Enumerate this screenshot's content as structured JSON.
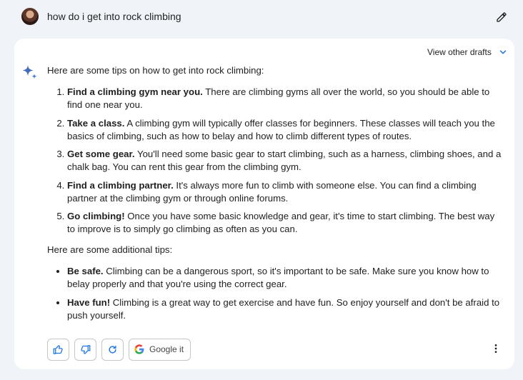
{
  "prompt": {
    "text": "how do i get into rock climbing"
  },
  "response": {
    "drafts_label": "View other drafts",
    "intro": "Here are some tips on how to get into rock climbing:",
    "steps": [
      {
        "title": "Find a climbing gym near you.",
        "body": " There are climbing gyms all over the world, so you should be able to find one near you."
      },
      {
        "title": "Take a class.",
        "body": " A climbing gym will typically offer classes for beginners. These classes will teach you the basics of climbing, such as how to belay and how to climb different types of routes."
      },
      {
        "title": "Get some gear.",
        "body": " You'll need some basic gear to start climbing, such as a harness, climbing shoes, and a chalk bag. You can rent this gear from the climbing gym."
      },
      {
        "title": "Find a climbing partner.",
        "body": " It's always more fun to climb with someone else. You can find a climbing partner at the climbing gym or through online forums."
      },
      {
        "title": "Go climbing!",
        "body": " Once you have some basic knowledge and gear, it's time to start climbing. The best way to improve is to simply go climbing as often as you can."
      }
    ],
    "additional_intro": "Here are some additional tips:",
    "additional": [
      {
        "title": "Be safe.",
        "body": " Climbing can be a dangerous sport, so it's important to be safe. Make sure you know how to belay properly and that you're using the correct gear."
      },
      {
        "title": "Have fun!",
        "body": " Climbing is a great way to get exercise and have fun. So enjoy yourself and don't be afraid to push yourself."
      }
    ]
  },
  "actions": {
    "google_label": "Google it"
  },
  "icons": {
    "edit": "pencil-icon",
    "chevron": "chevron-down-icon",
    "spark": "sparkle-icon",
    "thumbs_up": "thumbs-up-icon",
    "thumbs_down": "thumbs-down-icon",
    "regenerate": "refresh-icon",
    "google": "google-g-icon",
    "more": "more-vert-icon"
  },
  "colors": {
    "page_bg": "#f0f4f9",
    "card_bg": "#ffffff",
    "accent_blue": "#1a73e8",
    "text": "#1f1f1f"
  }
}
